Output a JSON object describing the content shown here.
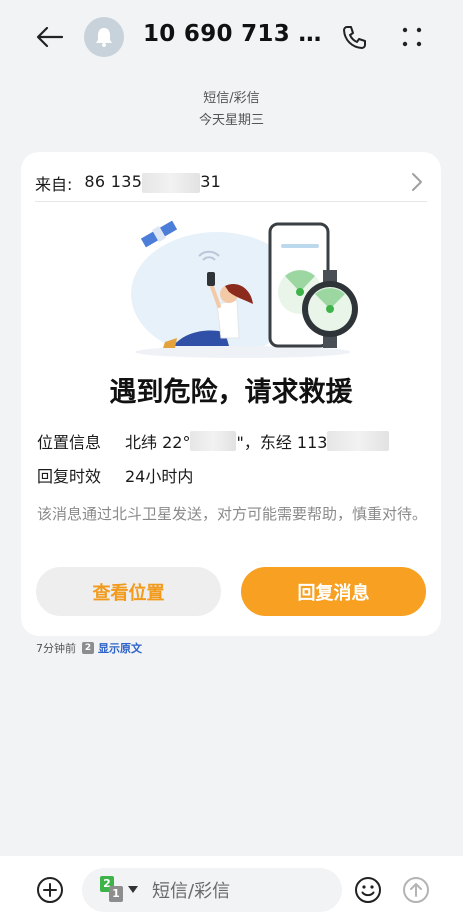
{
  "header": {
    "contact": "10 690 713 8…",
    "icons": [
      "back-arrow-icon",
      "bell-icon",
      "phone-icon",
      "more-icon"
    ]
  },
  "conversation": {
    "type_label": "短信/彩信",
    "date_label": "今天星期三"
  },
  "card": {
    "from_label": "来自:",
    "from_prefix": "86 135",
    "from_suffix": "31",
    "alert_title": "遇到危险，请求救援",
    "location_label": "位置信息",
    "location_lat_prefix": "北纬 22°",
    "location_lat_suffix": "\"，东经 113",
    "reply_window_label": "回复时效",
    "reply_window_value": "24小时内",
    "note": "该消息通过北斗卫星发送，对方可能需要帮助，慎重对待。",
    "view_location_button": "查看位置",
    "reply_button": "回复消息"
  },
  "meta": {
    "time_ago": "7分钟前",
    "sim_number": "2",
    "show_original": "显示原文"
  },
  "compose": {
    "placeholder": "短信/彩信",
    "sim_top": "2",
    "sim_bottom": "1"
  },
  "colors": {
    "accent": "#f7a021",
    "link": "#2e64c8",
    "sim_green": "#3db34a"
  }
}
